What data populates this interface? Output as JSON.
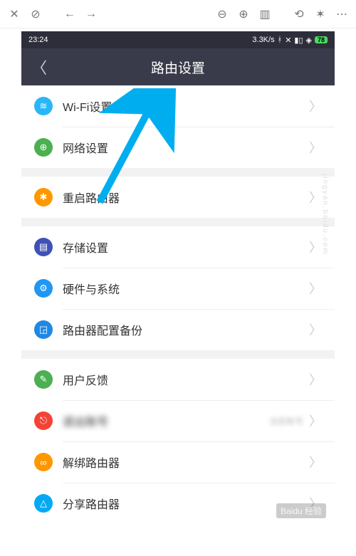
{
  "browser": {
    "icons": [
      "close",
      "stop",
      "back",
      "forward",
      "zoom-out",
      "zoom-in",
      "reader",
      "rotate",
      "tools",
      "more"
    ]
  },
  "statusbar": {
    "time": "23:24",
    "rate": "3.3K/s",
    "battery": "78"
  },
  "header": {
    "title": "路由设置"
  },
  "sections": [
    {
      "rows": [
        {
          "icon_color": "#29b6f6",
          "glyph": "≋",
          "label": "Wi-Fi设置",
          "name": "wifi-settings"
        },
        {
          "icon_color": "#4caf50",
          "glyph": "⊕",
          "label": "网络设置",
          "name": "network-settings"
        }
      ]
    },
    {
      "rows": [
        {
          "icon_color": "#ff9800",
          "glyph": "✱",
          "label": "重启路由器",
          "name": "restart-router"
        }
      ]
    },
    {
      "rows": [
        {
          "icon_color": "#3f51b5",
          "glyph": "▤",
          "label": "存储设置",
          "name": "storage-settings"
        },
        {
          "icon_color": "#2196f3",
          "glyph": "⚙",
          "label": "硬件与系统",
          "name": "hardware-system"
        },
        {
          "icon_color": "#1e88e5",
          "glyph": "◲",
          "label": "路由器配置备份",
          "name": "config-backup"
        }
      ]
    },
    {
      "rows": [
        {
          "icon_color": "#4caf50",
          "glyph": "✎",
          "label": "用户反馈",
          "name": "user-feedback"
        },
        {
          "icon_color": "#f44336",
          "glyph": "⎋",
          "label": "退出账号",
          "name": "logout",
          "blurred": true,
          "sub": "当前账号"
        },
        {
          "icon_color": "#ff9800",
          "glyph": "∞",
          "label": "解绑路由器",
          "name": "unbind-router"
        },
        {
          "icon_color": "#03a9f4",
          "glyph": "△",
          "label": "分享路由器",
          "name": "share-router"
        }
      ]
    }
  ],
  "watermark": "jingyan.baidu.com",
  "brand": "Baidu 经验"
}
